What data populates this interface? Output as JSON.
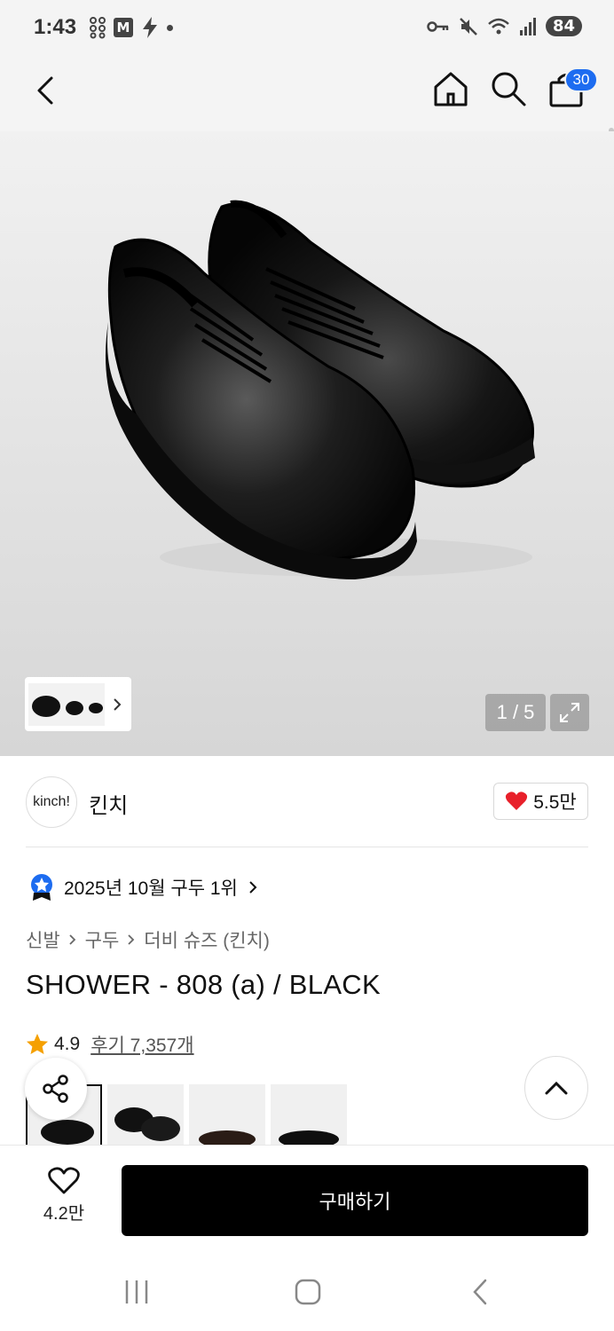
{
  "status_bar": {
    "time": "1:43",
    "mail_badge": "M",
    "battery": "84"
  },
  "header": {
    "cart_count": "30"
  },
  "gallery": {
    "counter": "1 / 5"
  },
  "brand": {
    "logo_text": "kinch!",
    "name": "킨치",
    "likes": "5.5만",
    "like_color": "#e8202a"
  },
  "product": {
    "rank_text": "2025년 10월 구두 1위",
    "breadcrumb": [
      "신발",
      "구두",
      "더비 슈즈 (킨치)"
    ],
    "title": "SHOWER - 808 (a) / BLACK",
    "rating": "4.9",
    "reviews": "후기 7,357개",
    "star_color": "#f5a000"
  },
  "bottom_bar": {
    "wish_count": "4.2만",
    "buy_label": "구매하기"
  },
  "colors": {
    "accent": "#1d6cf0",
    "buy_button": "#000000"
  }
}
